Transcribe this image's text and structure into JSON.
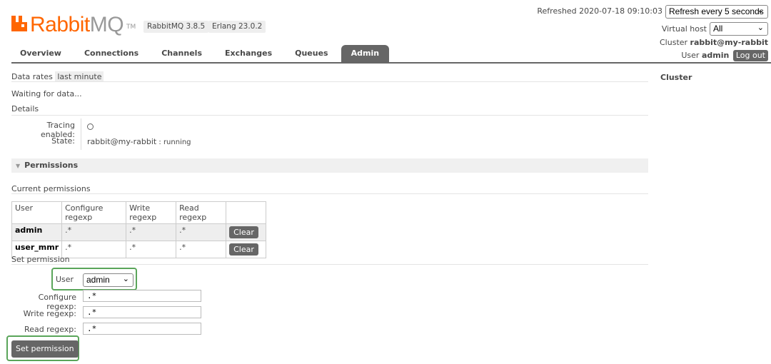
{
  "app": {
    "logo_rabbit": "Rabbit",
    "logo_mq": "MQ",
    "logo_tm": "TM",
    "version": "RabbitMQ 3.8.5",
    "erlang": "Erlang 23.0.2"
  },
  "nav": {
    "tabs": [
      {
        "label": "Overview"
      },
      {
        "label": "Connections"
      },
      {
        "label": "Channels"
      },
      {
        "label": "Exchanges"
      },
      {
        "label": "Queues"
      },
      {
        "label": "Admin"
      }
    ]
  },
  "header": {
    "refreshed": "Refreshed 2020-07-18 09:10:03",
    "refresh_select": "Refresh every 5 seconds",
    "vhost_label": "Virtual host",
    "vhost_value": "All",
    "cluster_label": "Cluster",
    "cluster_value": "rabbit@my-rabbit",
    "user_label": "User",
    "user_value": "admin",
    "logout": "Log out"
  },
  "main": {
    "data_rates_label": "Data rates",
    "data_rates_value": "last minute",
    "waiting": "Waiting for data...",
    "details": "Details",
    "tracing_label": "Tracing enabled:",
    "state_label": "State:",
    "state_node": "rabbit@my-rabbit",
    "state_sep": " : ",
    "state_value": "running",
    "permissions_header": "Permissions",
    "current_permissions": "Current permissions",
    "table": {
      "headers": [
        "User",
        "Configure regexp",
        "Write regexp",
        "Read regexp",
        ""
      ],
      "rows": [
        {
          "user": "admin",
          "configure": ".*",
          "write": ".*",
          "read": ".*",
          "action": "Clear"
        },
        {
          "user": "user_mmr",
          "configure": ".*",
          "write": ".*",
          "read": ".*",
          "action": "Clear"
        }
      ]
    },
    "set_permission_title": "Set permission",
    "form": {
      "user_label": "User",
      "user_value": "admin",
      "configure_label": "Configure regexp:",
      "configure_value": ".*",
      "write_label": "Write regexp:",
      "write_value": ".*",
      "read_label": "Read regexp:",
      "read_value": ".*",
      "submit": "Set permission"
    }
  },
  "sidebar": {
    "cluster": "Cluster"
  },
  "colors": {
    "brand_orange": "#ff6600",
    "tab_active": "#666666",
    "highlight_green": "#5aa55a"
  }
}
